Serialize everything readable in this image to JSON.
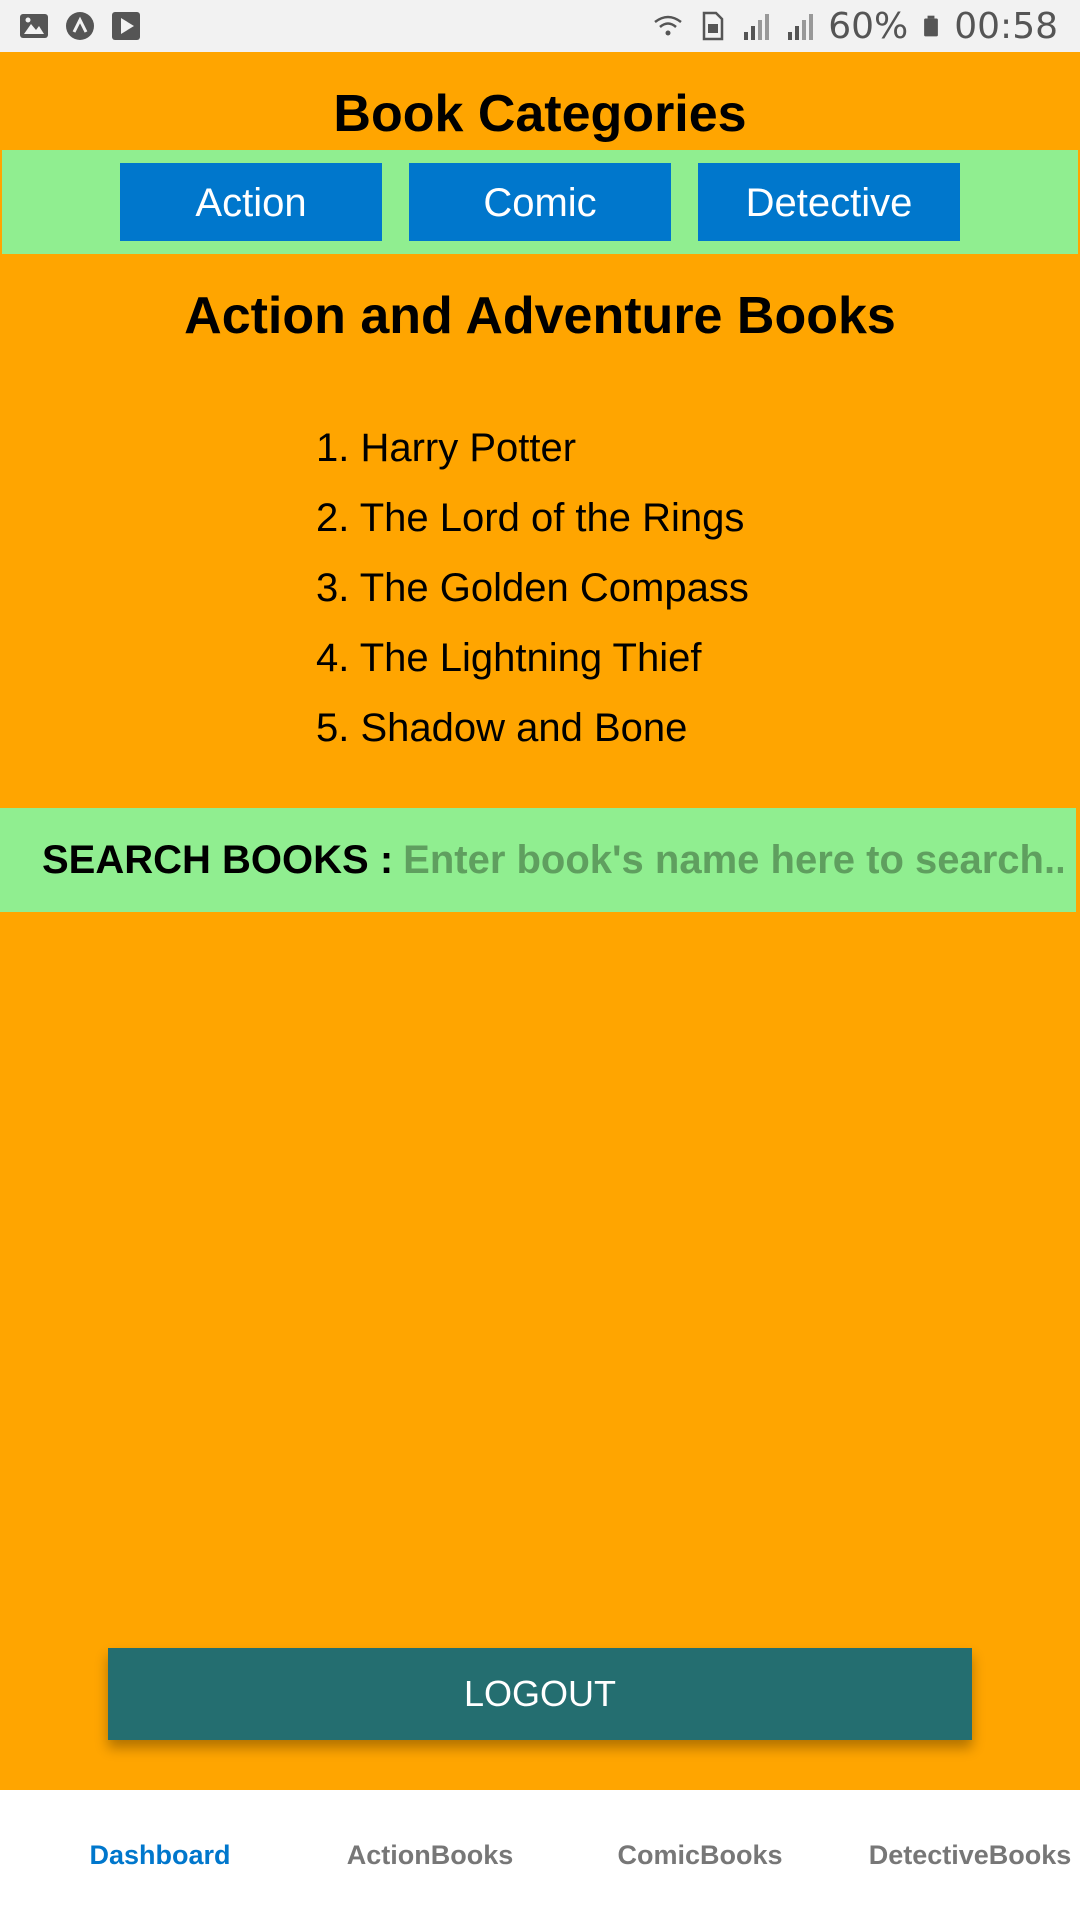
{
  "status_bar": {
    "left_icons": [
      "gallery-icon",
      "app-icon",
      "play-store-icon"
    ],
    "right_icons": [
      "wifi-icon",
      "sim-icon",
      "signal-icon",
      "signal-icon",
      "battery-icon"
    ],
    "battery": "60%",
    "time": "00:58"
  },
  "header": {
    "title": "Book Categories"
  },
  "categories": {
    "items": [
      {
        "label": "Action"
      },
      {
        "label": "Comic"
      },
      {
        "label": "Detective"
      }
    ]
  },
  "section": {
    "title": "Action and Adventure Books"
  },
  "books": [
    "1. Harry Potter",
    "2. The Lord of the Rings",
    "3. The Golden Compass",
    "4. The Lightning Thief",
    "5. Shadow and Bone"
  ],
  "search": {
    "label": "SEARCH BOOKS :",
    "placeholder": "Enter book's name here to search..",
    "value": ""
  },
  "logout": {
    "label": "LOGOUT"
  },
  "tabs": [
    {
      "label": "Dashboard",
      "active": true
    },
    {
      "label": "ActionBooks",
      "active": false
    },
    {
      "label": "ComicBooks",
      "active": false
    },
    {
      "label": "DetectiveBooks",
      "active": false
    }
  ],
  "colors": {
    "background": "#FFA500",
    "bar_green": "#90EE90",
    "button_blue": "#0077CC",
    "logout_teal": "#246E70",
    "tab_active": "#0077CC",
    "tab_inactive": "#777777"
  }
}
